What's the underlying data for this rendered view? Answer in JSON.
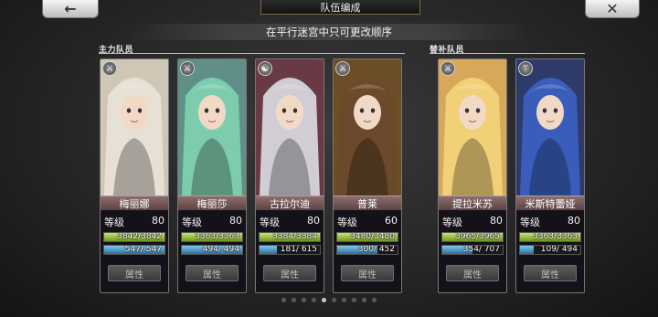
{
  "header": {
    "title": "队伍编成",
    "subtitle": "在平行迷宫中只可更改顺序"
  },
  "nav": {
    "back_glyph": "←",
    "close_glyph": "✕"
  },
  "groups": {
    "main": "主力队员",
    "sub": "替补队员"
  },
  "level_label": "等级",
  "attr_label": "属性",
  "characters": [
    {
      "name": "梅丽娜",
      "level": "80",
      "hp": "3842/3842",
      "mp": "547/ 547",
      "hp_ratio": 1.0,
      "mp_ratio": 1.0,
      "icon": "sword-icon",
      "icon_glyph": "⚔",
      "hair": "#e8e2d6",
      "bg": "#cfc6b6"
    },
    {
      "name": "梅丽莎",
      "level": "80",
      "hp": "3363/3363",
      "mp": "494/ 494",
      "hp_ratio": 1.0,
      "mp_ratio": 1.0,
      "icon": "sword-icon",
      "icon_glyph": "⚔",
      "hair": "#7fd0b0",
      "bg": "#5f8f86"
    },
    {
      "name": "古拉尔迪",
      "level": "80",
      "hp": "3384/3384",
      "mp": "181/ 615",
      "hp_ratio": 1.0,
      "mp_ratio": 0.29,
      "icon": "dragon-icon",
      "icon_glyph": "☯",
      "hair": "#d6d6dc",
      "bg": "#6a3a44"
    },
    {
      "name": "普莱",
      "level": "60",
      "hp": "3480/3480",
      "mp": "300/ 452",
      "hp_ratio": 1.0,
      "mp_ratio": 0.66,
      "icon": "sword-icon",
      "icon_glyph": "⚔",
      "hair": "#6a4a2a",
      "bg": "#6b4d26"
    },
    {
      "name": "提拉米苏",
      "level": "80",
      "hp": "3965/3965",
      "mp": "354/ 707",
      "hp_ratio": 1.0,
      "mp_ratio": 0.5,
      "icon": "sword-icon",
      "icon_glyph": "⚔",
      "hair": "#f2d27a",
      "bg": "#d8a85a"
    },
    {
      "name": "米斯特蕾娅",
      "level": "80",
      "hp": "3363/3363",
      "mp": "109/ 494",
      "hp_ratio": 1.0,
      "mp_ratio": 0.22,
      "icon": "staff-icon",
      "icon_glyph": "⚚",
      "hair": "#3b5fc0",
      "bg": "#2e3a6a"
    }
  ],
  "pagination": {
    "count": 10,
    "active": 4
  }
}
